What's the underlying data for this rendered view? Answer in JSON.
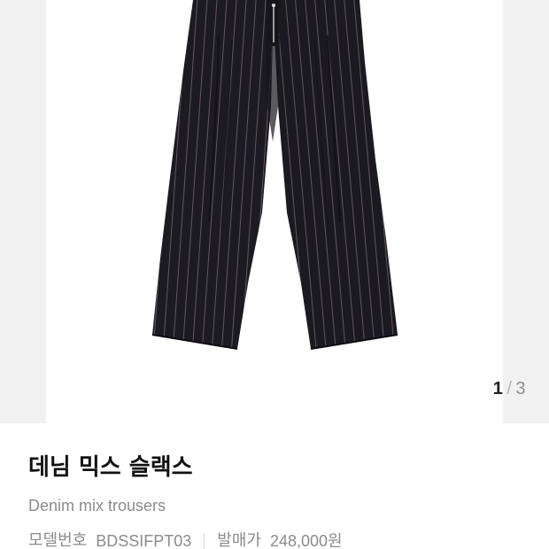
{
  "gallery": {
    "current_index": "1",
    "separator": "/",
    "total": "3",
    "image_name": "pinstripe-trousers-image"
  },
  "product": {
    "name_ko": "데님 믹스 슬랙스",
    "name_en": "Denim mix trousers",
    "model_label": "모델번호",
    "model_value": "BDSSIFPT03",
    "price_label": "발매가",
    "price_value": "248,000원"
  },
  "colors": {
    "fabric": "#1c1b24",
    "stripe": "#8a6a72",
    "background_edge": "#f1f1f1",
    "secondary_text": "#8b8b8b"
  }
}
